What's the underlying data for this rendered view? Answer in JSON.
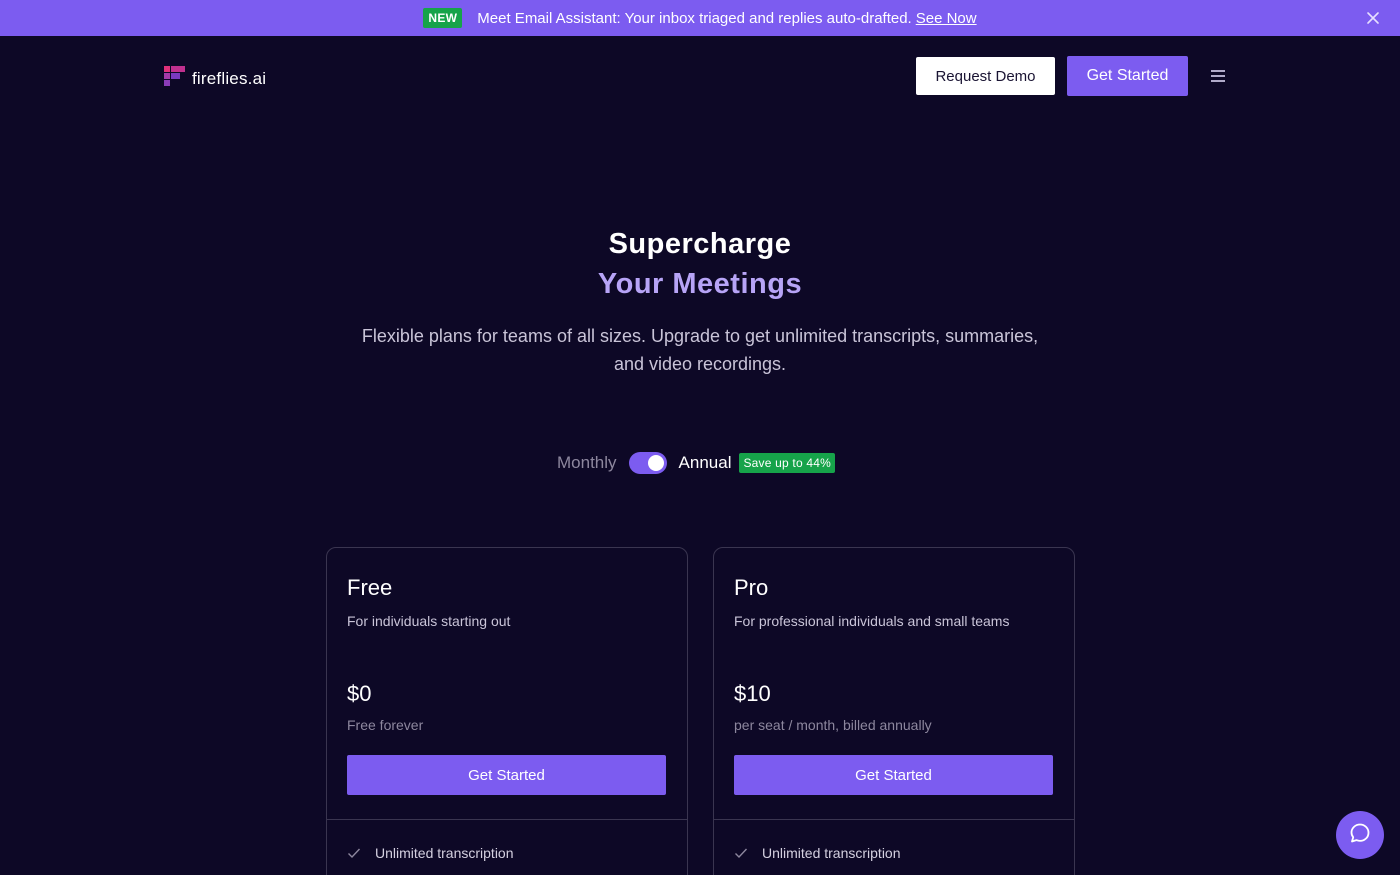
{
  "announcement": {
    "badge": "NEW",
    "message": "Meet Email Assistant: Your inbox triaged and replies auto-drafted.",
    "link": "See Now"
  },
  "header": {
    "logo_text": "fireflies.ai",
    "request_demo": "Request Demo",
    "get_started": "Get Started"
  },
  "hero": {
    "title_line1": "Supercharge",
    "title_line2": "Your Meetings",
    "subtitle": "Flexible plans for teams of all sizes. Upgrade to get unlimited transcripts, summaries, and video recordings."
  },
  "billing": {
    "monthly": "Monthly",
    "annual": "Annual",
    "selected": "Annual",
    "save_badge": "Save up to 44%"
  },
  "plans": [
    {
      "name": "Free",
      "description": "For individuals starting out",
      "price": "$0",
      "period": "Free forever",
      "cta": "Get Started",
      "features": [
        "Unlimited transcription"
      ]
    },
    {
      "name": "Pro",
      "description": "For professional individuals and small teams",
      "price": "$10",
      "period": "per seat / month, billed annually",
      "cta": "Get Started",
      "features": [
        "Unlimited transcription"
      ]
    }
  ],
  "colors": {
    "background": "#0d0826",
    "accent": "#7c5cf0",
    "accent_light": "#b7a4f7",
    "badge_green": "#16a34a"
  },
  "icons": {
    "close": "close-icon",
    "menu": "hamburger-menu-icon",
    "chat": "chat-bubble-icon",
    "check": "check-icon",
    "logo": "fireflies-logo-icon"
  }
}
